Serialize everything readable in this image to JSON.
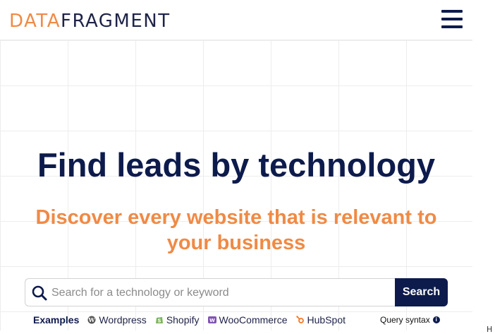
{
  "header": {
    "logo_part1": "DATA",
    "logo_part2": "FRAGMENT",
    "menu_icon": "hamburger-menu-icon"
  },
  "hero": {
    "title": "Find leads by technology",
    "subtitle": "Discover every website that is relevant to your business"
  },
  "search": {
    "placeholder": "Search for a technology or keyword",
    "value": "",
    "button_label": "Search",
    "icon": "search-icon"
  },
  "examples": {
    "label": "Examples",
    "items": [
      {
        "label": "Wordpress",
        "icon": "wordpress-icon"
      },
      {
        "label": "Shopify",
        "icon": "shopify-icon"
      },
      {
        "label": "WooCommerce",
        "icon": "woocommerce-icon"
      },
      {
        "label": "HubSpot",
        "icon": "hubspot-icon"
      }
    ]
  },
  "query_syntax": {
    "label": "Query syntax",
    "icon": "info-icon"
  },
  "gutter_mark": "H",
  "colors": {
    "navy": "#0d1b4c",
    "orange": "#f08a45"
  }
}
